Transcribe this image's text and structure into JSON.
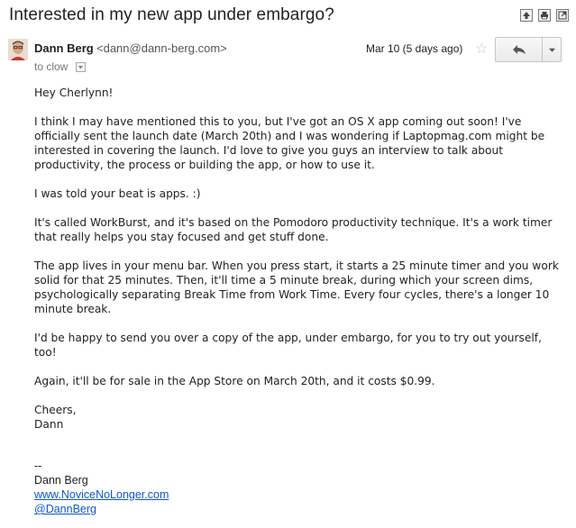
{
  "subject": "Interested in my new app under embargo?",
  "toolbar": {
    "icons": [
      "expand-all-icon",
      "print-icon",
      "new-window-icon"
    ]
  },
  "sender": {
    "name": "Dann Berg",
    "email": "<dann@dann-berg.com>",
    "to": "to clow",
    "date": "Mar 10 (5 days ago)"
  },
  "body": {
    "greeting": "Hey Cherlynn!",
    "p1": "I think I may have mentioned this to you, but I've got an OS X app coming out soon! I've officially sent the launch date (March 20th) and I was wondering if Laptopmag.com might be interested in covering the launch. I'd love to give you guys an interview to talk about productivity, the process or building the app, or how to use it.",
    "p2": "I was told your beat is apps. :)",
    "p3": "It's called WorkBurst, and it's based on the Pomodoro productivity technique. It's a work timer that really helps you stay focused and get stuff done.",
    "p4": "The app lives in your menu bar. When you press start, it starts a 25 minute timer and you work solid for that 25 minutes. Then, it'll time a 5 minute break, during which your screen dims, psychologically separating Break Time from Work Time. Every four cycles, there's a longer 10 minute break.",
    "p5": "I'd be happy to send you over a copy of the app, under embargo, for you to try out yourself, too!",
    "p6": "Again, it'll be for sale in the App Store on March 20th, and it costs $0.99.",
    "closing": "Cheers,",
    "closing_name": "Dann"
  },
  "signature": {
    "dashes": "--",
    "name": "Dann Berg",
    "website": "www.NoviceNoLonger.com",
    "twitter": "@DannBerg"
  }
}
